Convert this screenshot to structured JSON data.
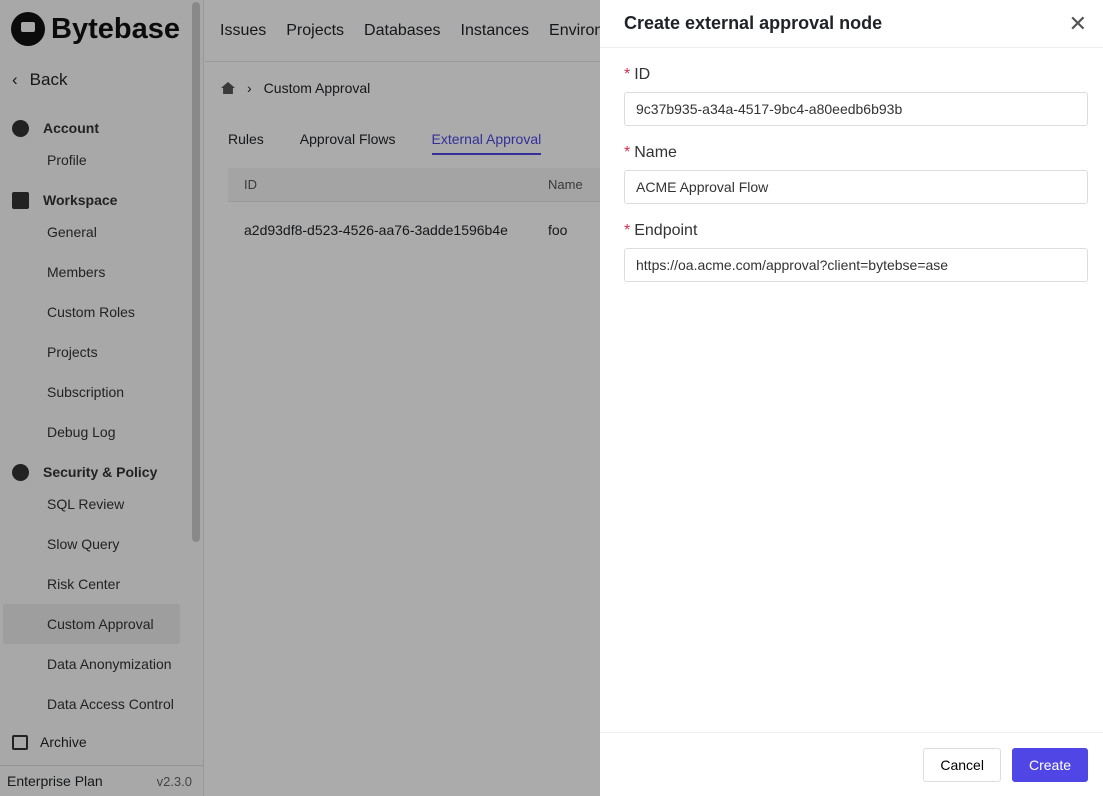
{
  "sidebar": {
    "logo": "Bytebase",
    "back": "Back",
    "sections": [
      {
        "label": "Account",
        "items": [
          "Profile"
        ]
      },
      {
        "label": "Workspace",
        "items": [
          "General",
          "Members",
          "Custom Roles",
          "Projects",
          "Subscription",
          "Debug Log"
        ]
      },
      {
        "label": "Security & Policy",
        "items": [
          "SQL Review",
          "Slow Query",
          "Risk Center",
          "Custom Approval",
          "Data Anonymization",
          "Data Access Control"
        ]
      }
    ],
    "active": "Custom Approval",
    "archive": "Archive",
    "plan": "Enterprise Plan",
    "version": "v2.3.0"
  },
  "topnav": [
    "Issues",
    "Projects",
    "Databases",
    "Instances",
    "Environ"
  ],
  "breadcrumb": {
    "current": "Custom Approval"
  },
  "tabs": [
    "Rules",
    "Approval Flows",
    "External Approval"
  ],
  "table": {
    "headers": [
      "ID",
      "Name"
    ],
    "rows": [
      [
        "a2d93df8-d523-4526-aa76-3adde1596b4e",
        "foo"
      ]
    ]
  },
  "drawer": {
    "title": "Create external approval node",
    "fields": [
      {
        "label": "ID",
        "value": "9c37b935-a34a-4517-9bc4-a80eedb6b93b"
      },
      {
        "label": "Name",
        "value": "ACME Approval Flow"
      },
      {
        "label": "Endpoint",
        "value": "https://oa.acme.com/approval?client=bytebse=ase"
      }
    ],
    "cancel": "Cancel",
    "create": "Create"
  },
  "colors": {
    "accent": "#4f46e5",
    "required": "#d03050"
  }
}
